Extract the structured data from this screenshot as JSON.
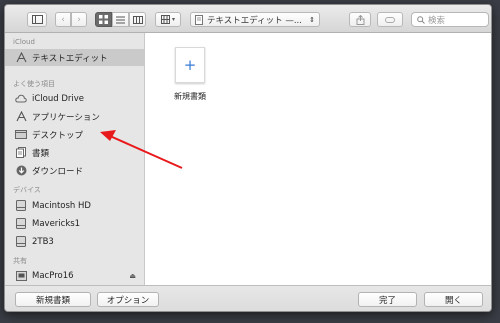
{
  "toolbar": {
    "path_label": "テキストエディット —...",
    "search_placeholder": "検索"
  },
  "sidebar": {
    "sections": [
      {
        "heading": "iCloud"
      },
      {
        "heading": "よく使う項目"
      },
      {
        "heading": "デバイス"
      },
      {
        "heading": "共有"
      }
    ],
    "icloud_items": [
      {
        "label": "テキストエディット",
        "icon": "textedit-app-icon",
        "selected": true
      }
    ],
    "favorites": [
      {
        "label": "iCloud Drive",
        "icon": "cloud-icon"
      },
      {
        "label": "アプリケーション",
        "icon": "applications-icon"
      },
      {
        "label": "デスクトップ",
        "icon": "desktop-icon"
      },
      {
        "label": "書類",
        "icon": "documents-icon"
      },
      {
        "label": "ダウンロード",
        "icon": "downloads-icon"
      }
    ],
    "devices": [
      {
        "label": "Macintosh HD",
        "icon": "hard-drive-icon"
      },
      {
        "label": "Mavericks1",
        "icon": "hard-drive-icon"
      },
      {
        "label": "2TB3",
        "icon": "hard-drive-icon"
      }
    ],
    "shared": [
      {
        "label": "MacPro16",
        "icon": "computer-icon",
        "eject": "⏏"
      }
    ]
  },
  "content": {
    "items": [
      {
        "label": "新規書類",
        "icon": "plus-icon",
        "glyph": "+"
      }
    ]
  },
  "bottom": {
    "new_document": "新規書類",
    "options": "オプション",
    "done": "完了",
    "open": "開く"
  },
  "annotation": {
    "color": "#e8191b"
  }
}
